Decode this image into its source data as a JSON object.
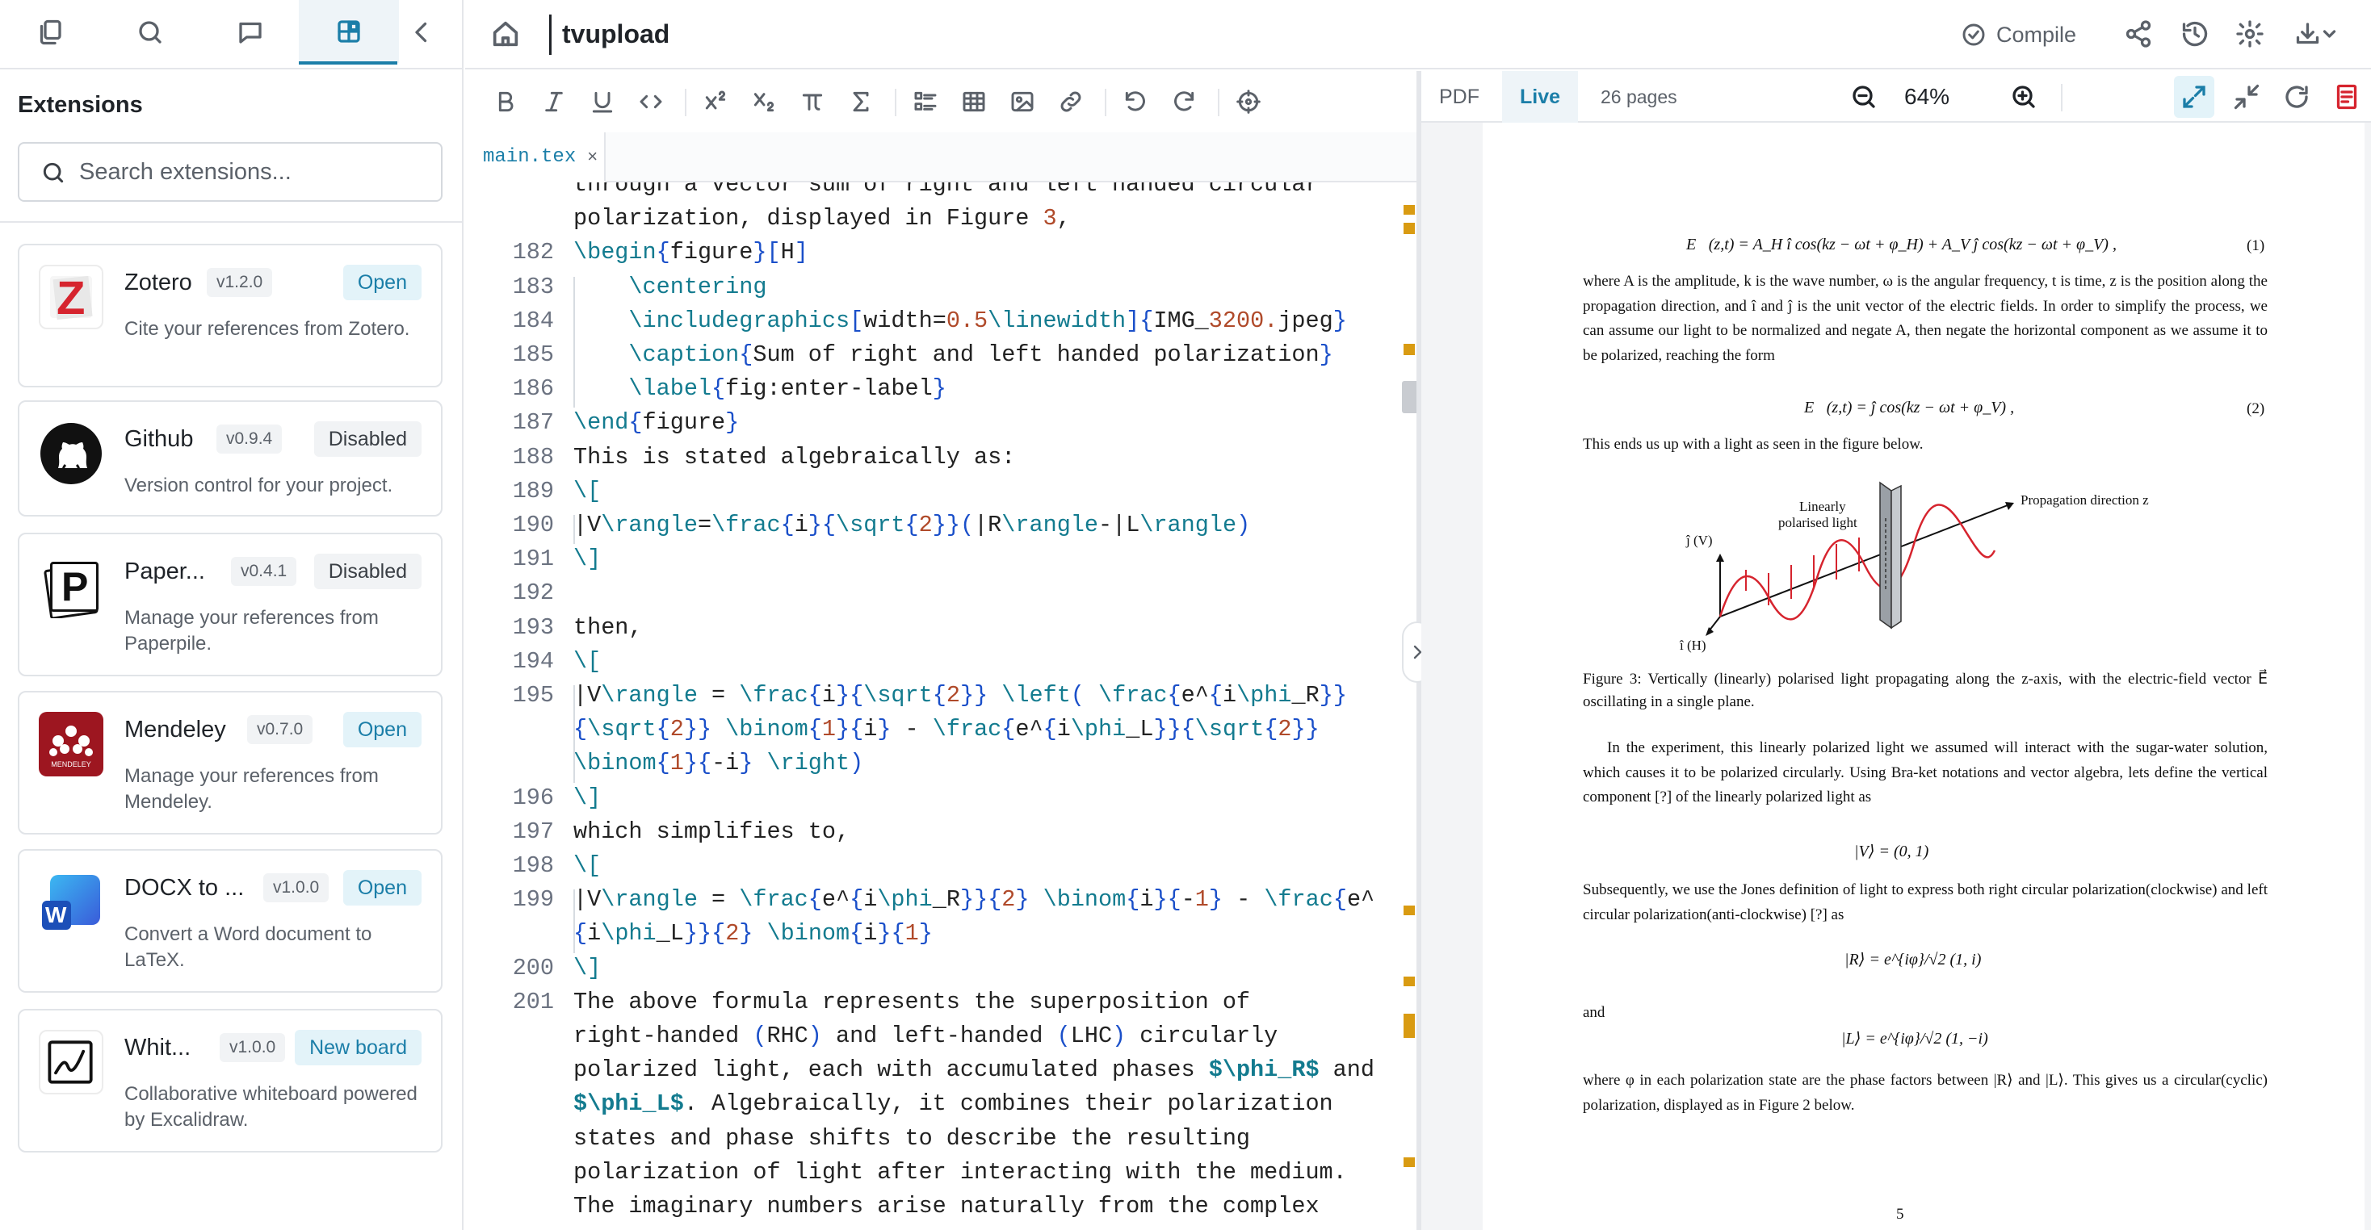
{
  "sidebar": {
    "title": "Extensions",
    "search_placeholder": "Search extensions...",
    "tabs": [
      "files-icon",
      "search-icon",
      "comments-icon",
      "extensions-icon",
      "collapse-icon"
    ],
    "extensions": [
      {
        "name": "Zotero",
        "version": "v1.2.0",
        "action": "Open",
        "description": "Cite your references from Zotero."
      },
      {
        "name": "Github",
        "version": "v0.9.4",
        "action": "Disabled",
        "description": "Version control for your project."
      },
      {
        "name": "Paper...",
        "version": "v0.4.1",
        "action": "Disabled",
        "description": "Manage your references from Paperpile."
      },
      {
        "name": "Mendeley",
        "version": "v0.7.0",
        "action": "Open",
        "description": "Manage your references from Mendeley."
      },
      {
        "name": "DOCX to ...",
        "version": "v1.0.0",
        "action": "Open",
        "description": "Convert a Word document to LaTeX."
      },
      {
        "name": "Whit...",
        "version": "v1.0.0",
        "action": "New board",
        "description": "Collaborative whiteboard powered by Excalidraw."
      }
    ],
    "logo_texts": {
      "zotero": "Z",
      "paperpile": "P",
      "mendeley": "MENDELEY",
      "docx": "W"
    }
  },
  "topbar": {
    "project_title": "tvupload",
    "compile_label": "Compile"
  },
  "editor": {
    "file_tab": "main.tex",
    "file_tab_close": "×",
    "lines": [
      {
        "n": "",
        "t": "through a vector sum of right and left handed circular"
      },
      {
        "n": "",
        "t": "polarization, displayed in Figure 3,"
      },
      {
        "n": "182",
        "t": "\\begin{figure}[H]"
      },
      {
        "n": "183",
        "t": "    \\centering"
      },
      {
        "n": "184",
        "t": "    \\includegraphics[width=0.5\\linewidth]{IMG_3200.jpeg}"
      },
      {
        "n": "185",
        "t": "    \\caption{Sum of right and left handed polarization}"
      },
      {
        "n": "186",
        "t": "    \\label{fig:enter-label}"
      },
      {
        "n": "187",
        "t": "\\end{figure}"
      },
      {
        "n": "188",
        "t": "This is stated algebraically as:"
      },
      {
        "n": "189",
        "t": "\\["
      },
      {
        "n": "190",
        "t": "|V\\rangle=\\frac{i}{\\sqrt{2}}(|R\\rangle-|L\\rangle)"
      },
      {
        "n": "191",
        "t": "\\]"
      },
      {
        "n": "192",
        "t": ""
      },
      {
        "n": "193",
        "t": "then,"
      },
      {
        "n": "194",
        "t": "\\["
      },
      {
        "n": "195",
        "t": "|V\\rangle = \\frac{i}{\\sqrt{2}} \\left( \\frac{e^{i\\phi_R}}"
      },
      {
        "n": "",
        "t": "{\\sqrt{2}} \\binom{1}{i} - \\frac{e^{i\\phi_L}}{\\sqrt{2}}"
      },
      {
        "n": "",
        "t": "\\binom{1}{-i} \\right)"
      },
      {
        "n": "196",
        "t": "\\]"
      },
      {
        "n": "197",
        "t": "which simplifies to,"
      },
      {
        "n": "198",
        "t": "\\["
      },
      {
        "n": "199",
        "t": "|V\\rangle = \\frac{e^{i\\phi_R}}{2} \\binom{i}{-1} - \\frac{e^"
      },
      {
        "n": "",
        "t": "{i\\phi_L}}{2} \\binom{i}{1}"
      },
      {
        "n": "200",
        "t": "\\]"
      },
      {
        "n": "201",
        "t": "The above formula represents the superposition of"
      },
      {
        "n": "",
        "t": "right-handed (RHC) and left-handed (LHC) circularly"
      },
      {
        "n": "",
        "t": "polarized light, each with accumulated phases $\\phi_R$ and"
      },
      {
        "n": "",
        "t": "$\\phi_L$. Algebraically, it combines their polarization"
      },
      {
        "n": "",
        "t": "states and phase shifts to describe the resulting"
      },
      {
        "n": "",
        "t": "polarization of light after interacting with the medium."
      },
      {
        "n": "",
        "t": "The imaginary numbers arise naturally from the complex"
      }
    ]
  },
  "preview": {
    "tab_pdf": "PDF",
    "tab_live": "Live",
    "pages": "26 pages",
    "zoom": "64%",
    "page_number": "5",
    "eq1": "E⃗(z,t) = A_H î cos(kz − ωt + φ_H) + A_V ĵ cos(kz − ωt + φ_V) ,",
    "eq1_num": "(1)",
    "para1": "where A is the amplitude, k is the wave number, ω is the angular frequency, t is time, z is the position along the propagation direction, and î and ĵ is the unit vector of the electric fields. In order to simplify the process, we can assume our light to be normalized and negate A, then negate the horizontal component as we assume it to be polarized, reaching the form",
    "eq2": "E⃗(z,t) = ĵ cos(kz − ωt + φ_V) ,",
    "eq2_num": "(2)",
    "para2": "This ends us up with a light as seen in the figure below.",
    "fig_labels": {
      "linear": "Linearly",
      "polarised": "polarised light",
      "propagation": "Propagation direction z",
      "jv": "ĵ (V)",
      "ih": "î (H)"
    },
    "caption": "Figure 3:  Vertically (linearly) polarised light propagating along the z-axis, with the electric-field vector E⃗ oscillating in a single plane.",
    "para3": "In the experiment, this linearly polarized light we assumed will interact with the sugar-water solution, which causes it to be polarized circularly. Using Bra-ket notations and vector algebra, lets define the vertical component [?] of the linearly polarized light as",
    "eqV": "|V⟩ = (0, 1)",
    "para4": "Subsequently, we use the Jones definition of light to express both right circular polarization(clockwise) and left circular polarization(anti-clockwise) [?] as",
    "eqR": "|R⟩ = e^{iφ}/√2 (1, i)",
    "and": "and",
    "eqL": "|L⟩ = e^{iφ}/√2 (1, −i)",
    "para5": "where φ in each polarization state are the phase factors between |R⟩ and |L⟩. This gives us a circular(cyclic) polarization, displayed as in Figure 2 below."
  },
  "colors": {
    "accent": "#1b7ea8",
    "latex_command": "#137b8f",
    "brace": "#1a4fc9",
    "number": "#b04a2a",
    "marker": "#d99b12"
  }
}
